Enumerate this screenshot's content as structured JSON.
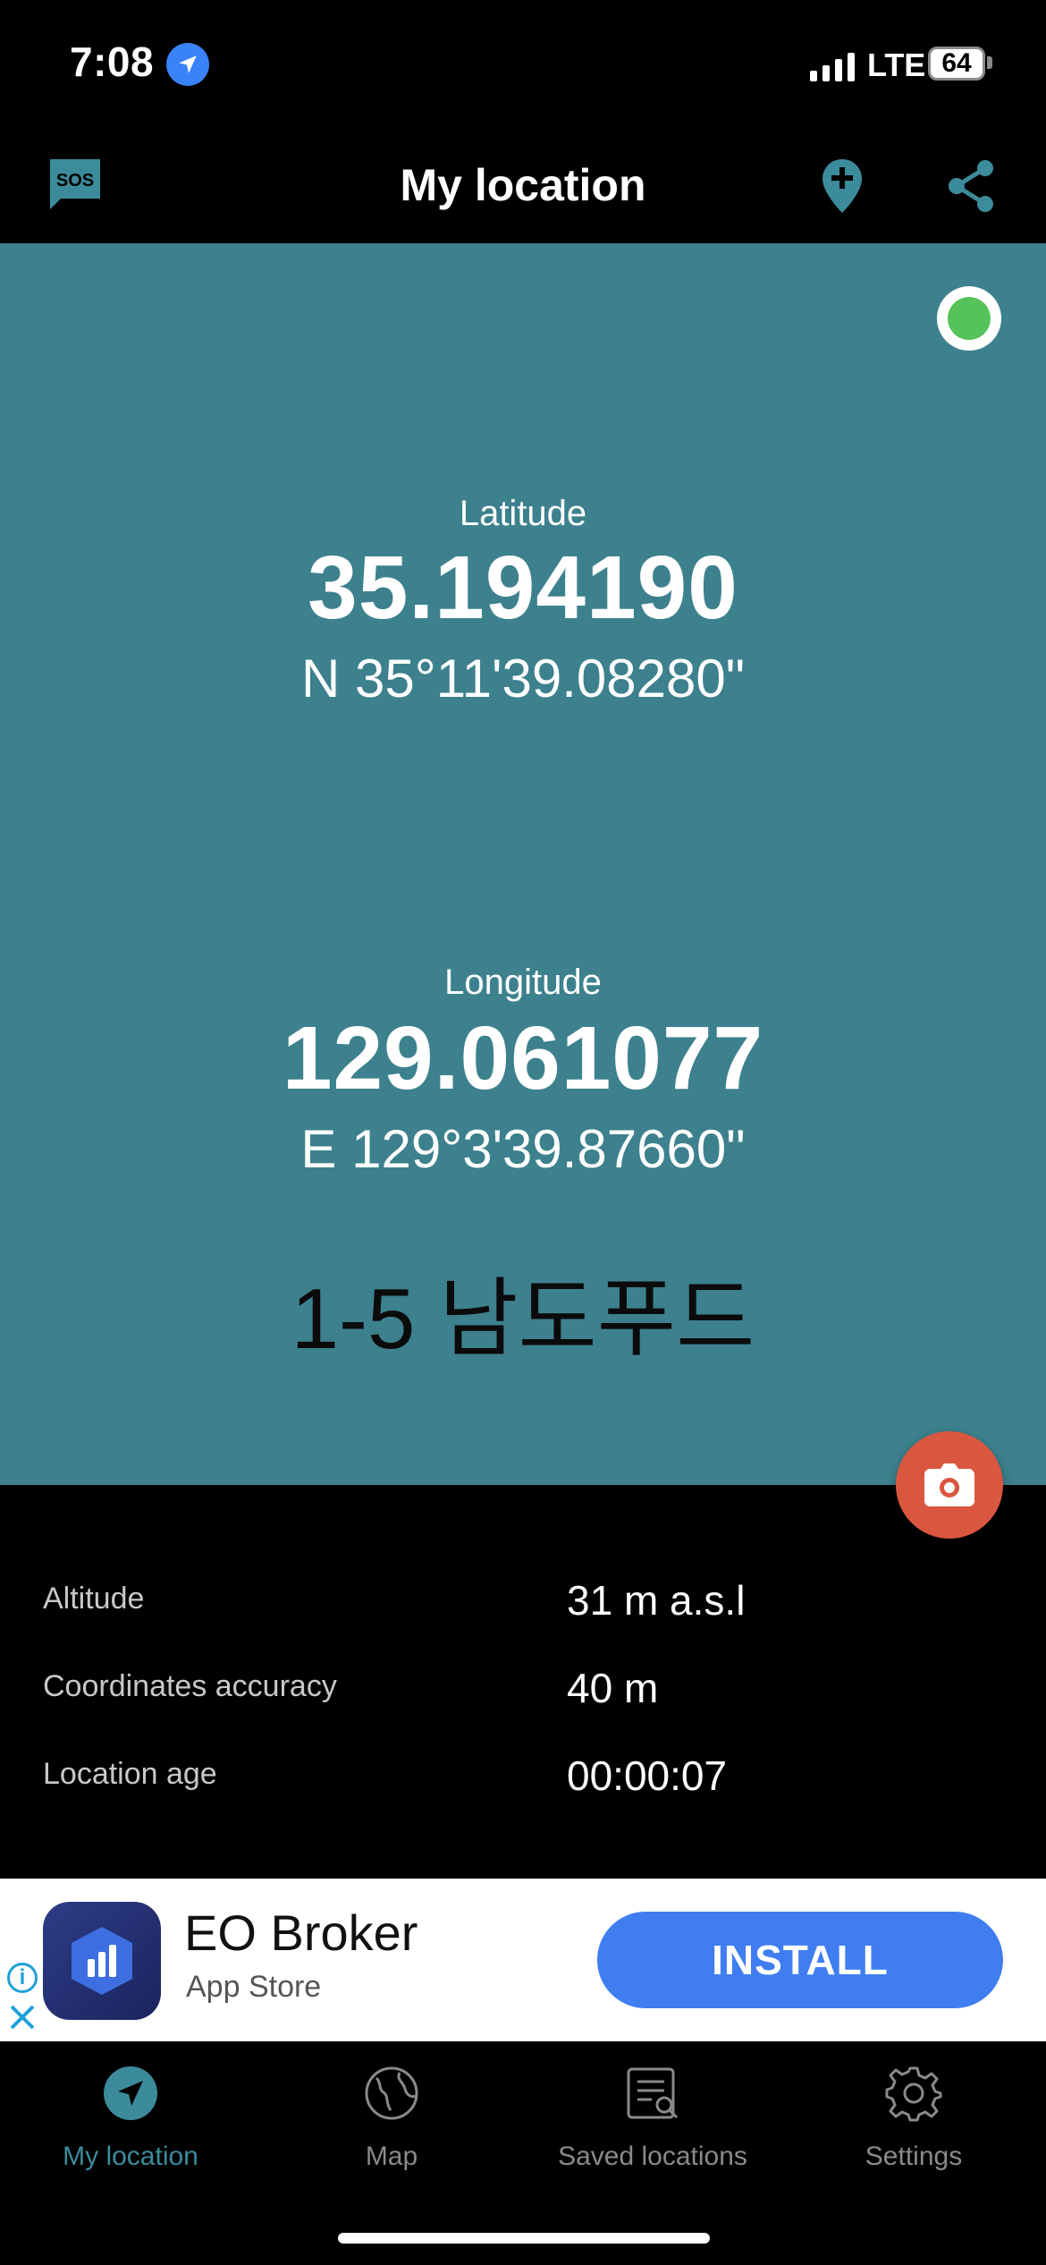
{
  "status_bar": {
    "time": "7:08",
    "network": "LTE",
    "battery": "64"
  },
  "header": {
    "title": "My location"
  },
  "location": {
    "latitude_label": "Latitude",
    "latitude": "35.194190",
    "latitude_dms": "N 35°11'39.08280\"",
    "longitude_label": "Longitude",
    "longitude": "129.061077",
    "longitude_dms": "E 129°3'39.87660\"",
    "address": "1-5 남도푸드"
  },
  "info": [
    {
      "label": "Altitude",
      "value": "31 m a.s.l"
    },
    {
      "label": "Coordinates accuracy",
      "value": "40 m"
    },
    {
      "label": "Location age",
      "value": "00:00:07"
    }
  ],
  "ad": {
    "title": "EO Broker",
    "subtitle": "App Store",
    "button": "INSTALL"
  },
  "tabs": [
    {
      "label": "My location",
      "icon": "navigation-arrow-icon",
      "active": true
    },
    {
      "label": "Map",
      "icon": "globe-icon",
      "active": false
    },
    {
      "label": "Saved locations",
      "icon": "saved-list-icon",
      "active": false
    },
    {
      "label": "Settings",
      "icon": "gear-icon",
      "active": false
    }
  ],
  "colors": {
    "panel": "#3c818d",
    "accent": "#3c8b9b",
    "camera": "#d9573f",
    "install": "#3f7df1",
    "live": "#55c35a"
  }
}
